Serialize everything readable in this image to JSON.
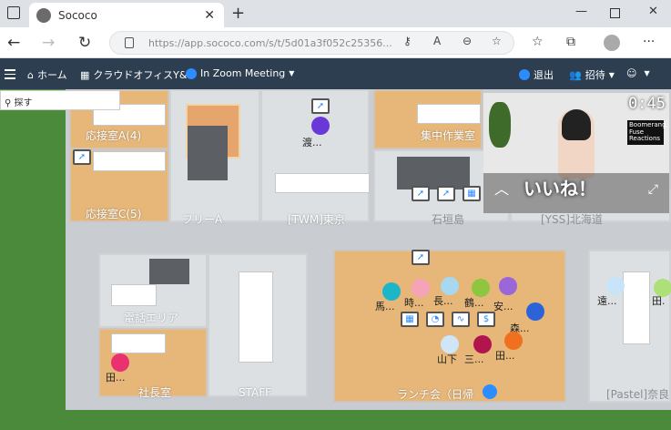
{
  "browser": {
    "tab_title": "Sococo",
    "url": "https://app.sococo.com/s/t/5d01a3f052c25356..."
  },
  "header": {
    "home": "ホーム",
    "office": "クラウドオフィスY&T",
    "meeting": "In Zoom Meeting",
    "leave": "退出",
    "invite": "招待"
  },
  "search": {
    "label": "探す"
  },
  "video": {
    "timer": "0:45",
    "caption": "いいね！",
    "mug": "Boomerang, Fuse Reactions"
  },
  "rooms": {
    "r1": "応接室A(4)",
    "r2": "応接室C(5)",
    "r3": "フリーA",
    "r4": "[TWM]東京",
    "r5": "石垣島",
    "r6": "[YSS]北海道",
    "r7": "集中作業室",
    "r8": "電話エリア",
    "r9": "社長室",
    "r10": "STAFF",
    "r11": "ランチ会（日帰",
    "r12": "[Pastel]奈良"
  },
  "people": {
    "p1": "渡...",
    "p2": "馬...",
    "p3": "時...",
    "p4": "長...",
    "p5": "鶴...",
    "p6": "安...",
    "p7": "森...",
    "p8": "山下",
    "p9": "三...",
    "p10": "田...",
    "p11": "田...",
    "p12": "遠...",
    "p13": "田."
  },
  "colors": {
    "header_bg": "#2d3e50",
    "grass": "#4b8a3a",
    "wood": "#e7b77a",
    "zoom_blue": "#2d8cff"
  }
}
